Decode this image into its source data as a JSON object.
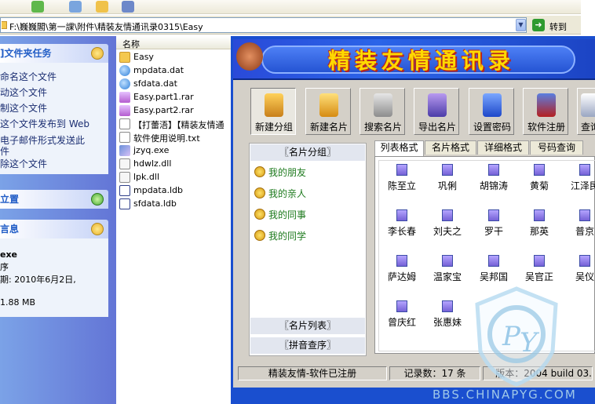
{
  "explorer": {
    "address": "F:\\巍巍閣\\第一課\\附件\\精裝友情通讯录0315\\Easy",
    "go_label": "转到",
    "column_name": "名称",
    "files": [
      {
        "name": "Easy",
        "type": "folder"
      },
      {
        "name": "mpdata.dat",
        "type": "dat"
      },
      {
        "name": "sfdata.dat",
        "type": "dat"
      },
      {
        "name": "Easy.part1.rar",
        "type": "rar"
      },
      {
        "name": "Easy.part2.rar",
        "type": "rar"
      },
      {
        "name": "【打蕾浯】【精装友情通",
        "type": "txt"
      },
      {
        "name": "软件使用说明.txt",
        "type": "txt"
      },
      {
        "name": "jzyq.exe",
        "type": "exe"
      },
      {
        "name": "hdwlz.dll",
        "type": "dll"
      },
      {
        "name": "lpk.dll",
        "type": "dll"
      },
      {
        "name": "mpdata.ldb",
        "type": "ldb"
      },
      {
        "name": "sfdata.ldb",
        "type": "ldb"
      }
    ]
  },
  "taskpane": {
    "file_tasks_title": "]文件夹任务",
    "tasks": [
      "命名这个文件",
      "动这个文件",
      "制这个文件",
      "这个文件发布到 Web",
      "电子邮件形式发送此",
      "件",
      "除这个文件"
    ],
    "places_title": "立置",
    "details_title": "言息",
    "details": [
      "exe",
      "序",
      "期: 2010年6月2日,",
      "1.88 MB"
    ]
  },
  "app": {
    "title": "精装友情通讯录",
    "tools": [
      "新建分组",
      "新建名片",
      "搜索名片",
      "导出名片",
      "设置密码",
      "软件注册",
      "查询"
    ],
    "groups_header": "〖名片分组〗",
    "groups": [
      "我的朋友",
      "我的亲人",
      "我的同事",
      "我的同学"
    ],
    "list_button": "〖名片列表〗",
    "pinyin_button": "〖拼音查序〗",
    "tabs": [
      "列表格式",
      "名片格式",
      "详细格式",
      "号码查询"
    ],
    "contacts": [
      "陈至立",
      "巩俐",
      "胡锦涛",
      "黄菊",
      "江泽民",
      "李长春",
      "刘夫之",
      "罗干",
      "那英",
      "普京",
      "萨达姆",
      "温家宝",
      "吴邦国",
      "吴官正",
      "吴仪",
      "曾庆红",
      "张惠妹"
    ],
    "status": [
      "精装友情-软件已注册",
      "记录数：17 条",
      "版本：2004 build 03."
    ]
  },
  "watermark": "BBS.CHINAPYG.COM",
  "colors": {
    "title_yellow": "#ffd900",
    "group_green": "#1d7a1d",
    "taskpane_blue": "#215dc6"
  }
}
